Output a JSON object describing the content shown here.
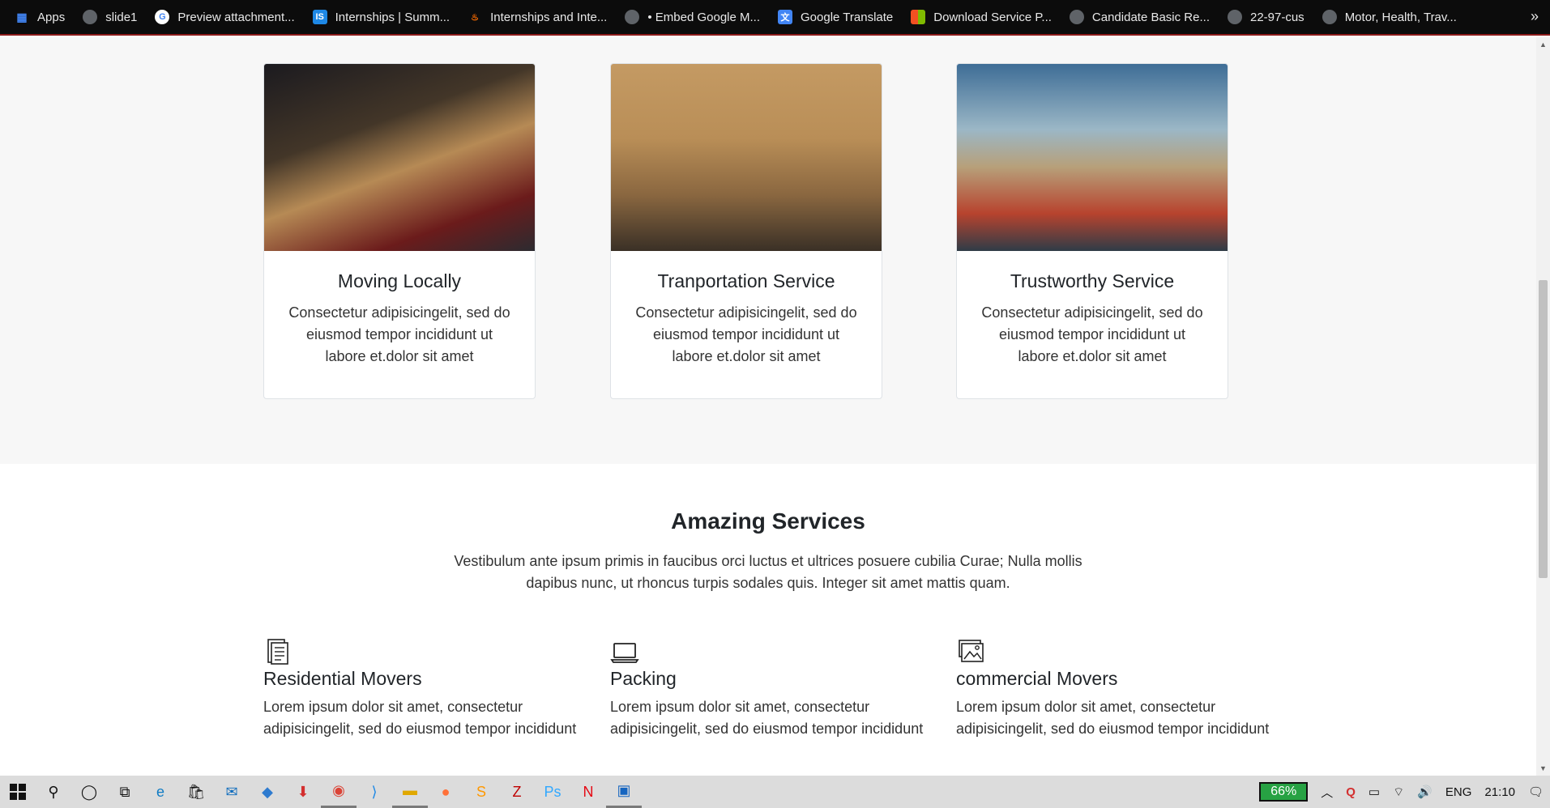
{
  "bookmarks": [
    {
      "label": "Apps",
      "icon": "apps-grid-icon"
    },
    {
      "label": "slide1",
      "icon": "globe-icon"
    },
    {
      "label": "Preview attachment...",
      "icon": "google-icon"
    },
    {
      "label": "Internships | Summ...",
      "icon": "internshala-icon"
    },
    {
      "label": "Internships and Inte...",
      "icon": "flame-icon"
    },
    {
      "label": "• Embed Google M...",
      "icon": "globe-icon"
    },
    {
      "label": "Google Translate",
      "icon": "google-translate-icon"
    },
    {
      "label": "Download Service P...",
      "icon": "microsoft-icon"
    },
    {
      "label": "Candidate Basic Re...",
      "icon": "globe-icon"
    },
    {
      "label": "22-97-cus",
      "icon": "globe-icon"
    },
    {
      "label": "Motor, Health, Trav...",
      "icon": "globe-icon"
    }
  ],
  "cards": [
    {
      "title": "Moving Locally",
      "text": "Consectetur adipisicingelit, sed do eiusmod tempor incididunt ut labore et.dolor sit amet"
    },
    {
      "title": "Tranportation Service",
      "text": "Consectetur adipisicingelit, sed do eiusmod tempor incididunt ut labore et.dolor sit amet"
    },
    {
      "title": "Trustworthy Service",
      "text": "Consectetur adipisicingelit, sed do eiusmod tempor incididunt ut labore et.dolor sit amet"
    }
  ],
  "services": {
    "title": "Amazing Services",
    "subtitle": "Vestibulum ante ipsum primis in faucibus orci luctus et ultrices posuere cubilia Curae; Nulla mollis dapibus nunc, ut rhoncus turpis sodales quis. Integer sit amet mattis quam.",
    "items": [
      {
        "title": "Residential Movers",
        "text": "Lorem ipsum dolor sit amet, consectetur adipisicingelit, sed do eiusmod tempor incididunt",
        "icon": "document-icon"
      },
      {
        "title": "Packing",
        "text": "Lorem ipsum dolor sit amet, consectetur adipisicingelit, sed do eiusmod tempor incididunt",
        "icon": "laptop-icon"
      },
      {
        "title": "commercial Movers",
        "text": "Lorem ipsum dolor sit amet, consectetur adipisicingelit, sed do eiusmod tempor incididunt",
        "icon": "gallery-icon"
      }
    ]
  },
  "taskbar": {
    "battery": "66%",
    "language": "ENG",
    "time": "21:10"
  }
}
